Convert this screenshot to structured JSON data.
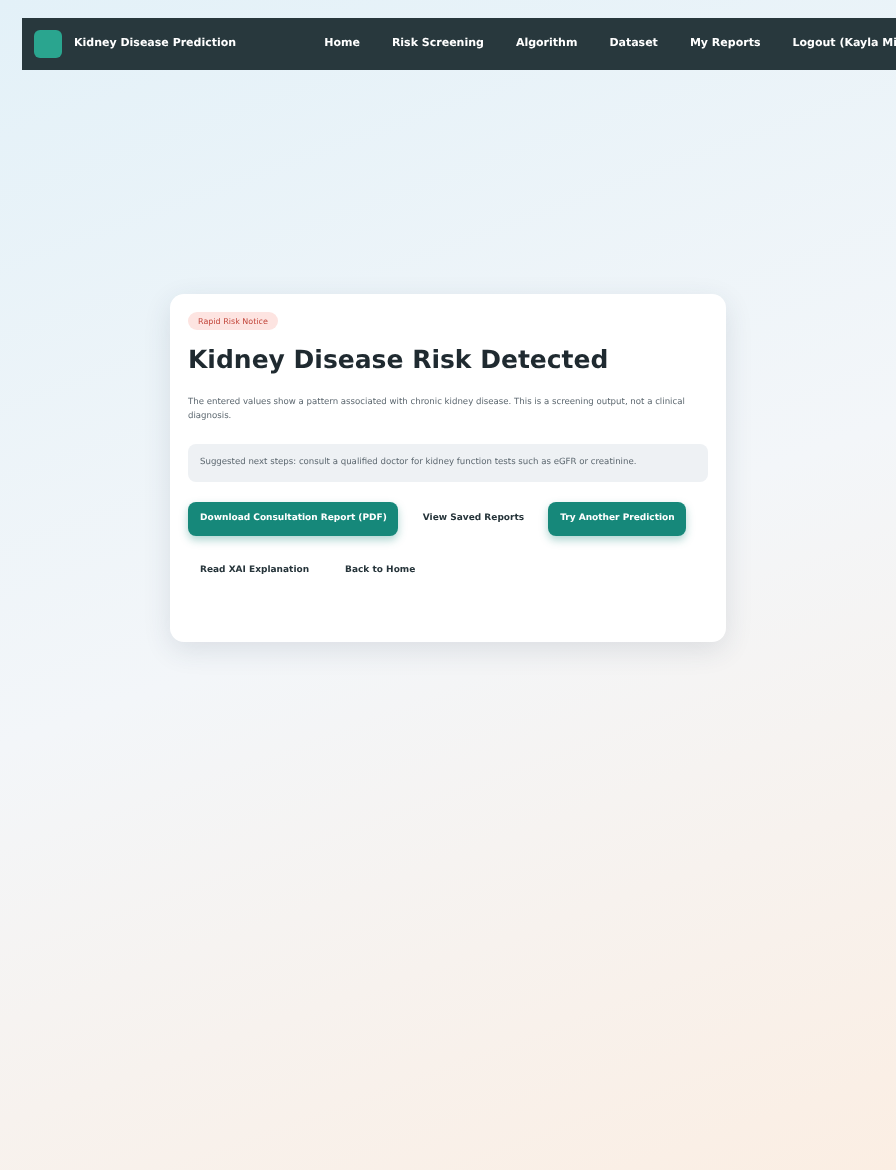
{
  "nav": {
    "brand": "Kidney Disease Prediction",
    "links": [
      {
        "label": "Home"
      },
      {
        "label": "Risk Screening"
      },
      {
        "label": "Algorithm"
      },
      {
        "label": "Dataset"
      },
      {
        "label": "My Reports"
      },
      {
        "label": "Logout (Kayla Mi"
      }
    ]
  },
  "result": {
    "badge": "Rapid Risk Notice",
    "title": "Kidney Disease Risk Detected",
    "description": "The entered values show a pattern associated with chronic kidney disease. This is a screening output, not a clinical diagnosis.",
    "note": "Suggested next steps: consult a qualified doctor for kidney function tests such as eGFR or creatinine.",
    "actions": [
      {
        "label": "Download Consultation Report (PDF)",
        "kind": "primary"
      },
      {
        "label": "View Saved Reports",
        "kind": "plain"
      },
      {
        "label": "Try Another Prediction",
        "kind": "primary"
      },
      {
        "label": "Read XAI Explanation",
        "kind": "plain"
      },
      {
        "label": "Back to Home",
        "kind": "plain"
      }
    ]
  }
}
